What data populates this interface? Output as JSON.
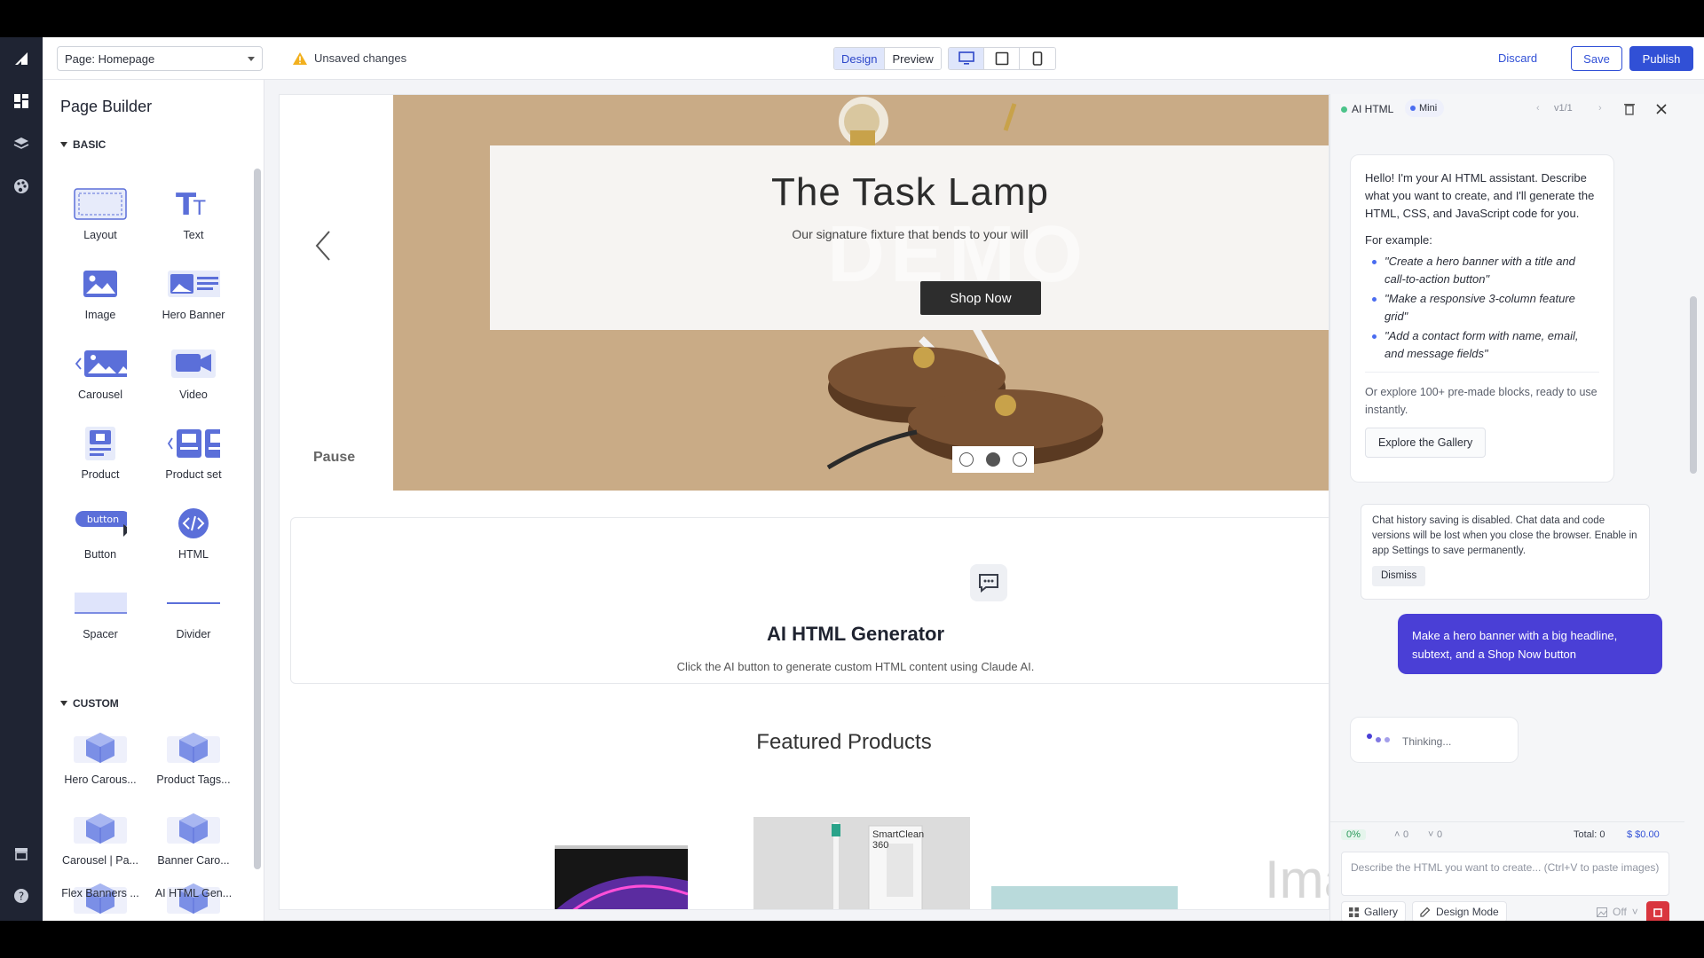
{
  "topbar": {
    "page_select": "Page: Homepage",
    "unsaved": "Unsaved changes",
    "modes": [
      "Design",
      "Preview"
    ],
    "discard": "Discard",
    "save": "Save",
    "publish": "Publish"
  },
  "sidebar": {
    "title": "Page Builder",
    "basic_label": "BASIC",
    "custom_label": "CUSTOM",
    "basic": [
      "Layout",
      "Text",
      "Image",
      "Hero Banner",
      "Carousel",
      "Video",
      "Product",
      "Product set",
      "Button",
      "HTML",
      "Spacer",
      "Divider"
    ],
    "button_tile_text": "button",
    "custom": [
      "Hero Carous...",
      "Product Tags...",
      "Carousel | Pa...",
      "Banner Caro...",
      "Flex Banners ...",
      "AI HTML Gen..."
    ]
  },
  "hero": {
    "title": "The Task Lamp",
    "subtitle": "Our signature fixture that bends to your will",
    "cta": "Shop Now",
    "watermark": "DEMO",
    "pause": "Pause"
  },
  "generator": {
    "title": "AI HTML Generator",
    "subtitle": "Click the AI button to generate custom HTML content using Claude AI."
  },
  "featured": {
    "title": "Featured Products",
    "product_box_text": "SmartClean 360",
    "partial_text": "Ima"
  },
  "ai_panel": {
    "name": "AI HTML",
    "model": "Mini",
    "version": "v1/1",
    "intro": "Hello! I'm your AI HTML assistant. Describe what you want to create, and I'll generate the HTML, CSS, and JavaScript code for you.",
    "example_label": "For example:",
    "examples": [
      "\"Create a hero banner with a title and call-to-action button\"",
      "\"Make a responsive 3-column feature grid\"",
      "\"Add a contact form with name, email, and message fields\""
    ],
    "explore_text": "Or explore 100+ pre-made blocks, ready to use instantly.",
    "explore_btn": "Explore the Gallery",
    "notice": "Chat history saving is disabled. Chat data and code versions will be lost when you close the browser. Enable in app Settings to save permanently.",
    "dismiss": "Dismiss",
    "user_msg": "Make a hero banner with a big headline, subtext, and a Shop Now button",
    "thinking": "Thinking...",
    "pct": "0%",
    "up_count": "0",
    "down_count": "0",
    "total": "Total: 0",
    "cost": "$ $0.00",
    "input_placeholder": "Describe the HTML you want to create... (Ctrl+V to paste images)",
    "gallery": "Gallery",
    "design_mode": "Design Mode",
    "image_toggle": "Off"
  },
  "colors": {
    "accent": "#3150d6",
    "user_bubble": "#4a3fd6",
    "rail": "#1f2433",
    "send": "#d9363e",
    "hero_bg": "#c9ab86"
  }
}
